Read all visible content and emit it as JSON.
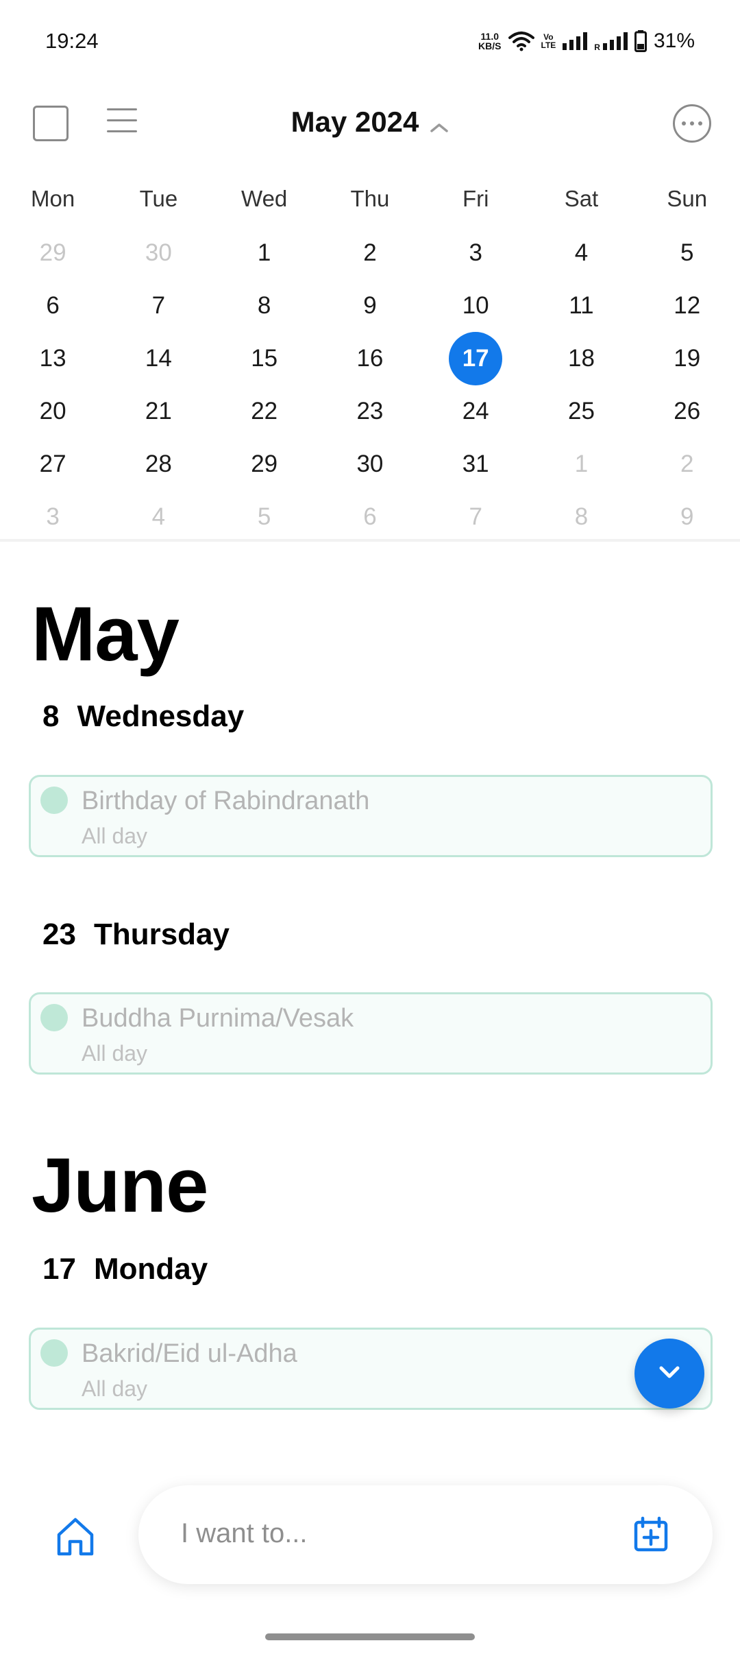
{
  "status_bar": {
    "time": "19:24",
    "net_speed_value": "11.0",
    "net_speed_unit": "KB/S",
    "volte_top": "Vo",
    "volte_bottom": "LTE",
    "roaming_mark": "R",
    "battery": "31%",
    "icons": [
      "wifi-icon",
      "signal-icon",
      "signal-icon",
      "battery-icon"
    ]
  },
  "toolbar": {
    "title": "May 2024",
    "icons": [
      "checkbox-icon",
      "list-icon",
      "chevron-up-icon",
      "more-icon"
    ]
  },
  "calendar": {
    "weekdays": [
      "Mon",
      "Tue",
      "Wed",
      "Thu",
      "Fri",
      "Sat",
      "Sun"
    ],
    "weeks": [
      [
        "29",
        "30",
        "1",
        "2",
        "3",
        "4",
        "5"
      ],
      [
        "6",
        "7",
        "8",
        "9",
        "10",
        "11",
        "12"
      ],
      [
        "13",
        "14",
        "15",
        "16",
        "17",
        "18",
        "19"
      ],
      [
        "20",
        "21",
        "22",
        "23",
        "24",
        "25",
        "26"
      ],
      [
        "27",
        "28",
        "29",
        "30",
        "31",
        "1",
        "2"
      ],
      [
        "3",
        "4",
        "5",
        "6",
        "7",
        "8",
        "9"
      ]
    ],
    "today": "17"
  },
  "agenda": {
    "may": {
      "month": "May",
      "date1_num": "8",
      "date1_day": "Wednesday",
      "event1_title": "Birthday of Rabindranath",
      "event1_sub": "All day",
      "date2_num": "23",
      "date2_day": "Thursday",
      "event2_title": "Buddha Purnima/Vesak",
      "event2_sub": "All day"
    },
    "june": {
      "month": "June",
      "date1_num": "17",
      "date1_day": "Monday",
      "event1_title": "Bakrid/Eid ul-Adha",
      "event1_sub": "All day"
    }
  },
  "bottom": {
    "input_placeholder": "I want to...",
    "icons": [
      "home-icon",
      "calendar-add-icon",
      "chevron-down-icon"
    ]
  },
  "colors": {
    "accent": "#1279ea",
    "event_border": "#bfe6d8",
    "event_dot": "#bfe8d7"
  }
}
